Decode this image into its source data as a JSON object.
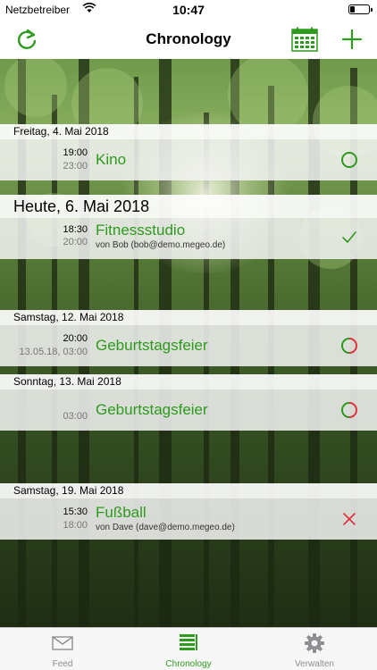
{
  "status_bar": {
    "carrier": "Netzbetreiber",
    "time": "10:47"
  },
  "nav": {
    "title": "Chronology"
  },
  "colors": {
    "accent": "#2e9a1e",
    "done": "#2e9a1e",
    "cancel": "#e0303a"
  },
  "days": [
    {
      "header": "Freitag, 4. Mai 2018",
      "events": [
        {
          "start": "19:00",
          "end": "23:00",
          "title": "Kino",
          "sub": "",
          "status": "open"
        }
      ]
    },
    {
      "header": "Heute, 6. Mai 2018",
      "events": [
        {
          "start": "18:30",
          "end": "20:00",
          "title": "Fitnessstudio",
          "sub": "von Bob (bob@demo.megeo.de)",
          "status": "done"
        }
      ]
    },
    {
      "header": "Samstag, 12. Mai 2018",
      "events": [
        {
          "start": "20:00",
          "end": "13.05.18, 03:00",
          "title": "Geburtstagsfeier",
          "sub": "",
          "status": "partial"
        }
      ]
    },
    {
      "header": "Sonntag, 13. Mai 2018",
      "events": [
        {
          "start": "",
          "end": "03:00",
          "title": "Geburtstagsfeier",
          "sub": "",
          "status": "partial"
        }
      ]
    },
    {
      "header": "Samstag, 19. Mai 2018",
      "events": [
        {
          "start": "15:30",
          "end": "18:00",
          "title": "Fußball",
          "sub": "von Dave (dave@demo.megeo.de)",
          "status": "cancelled"
        }
      ]
    }
  ],
  "tabs": [
    {
      "label": "Feed",
      "icon": "mail-icon"
    },
    {
      "label": "Chronology",
      "icon": "list-icon"
    },
    {
      "label": "Verwalten",
      "icon": "gear-icon"
    }
  ]
}
